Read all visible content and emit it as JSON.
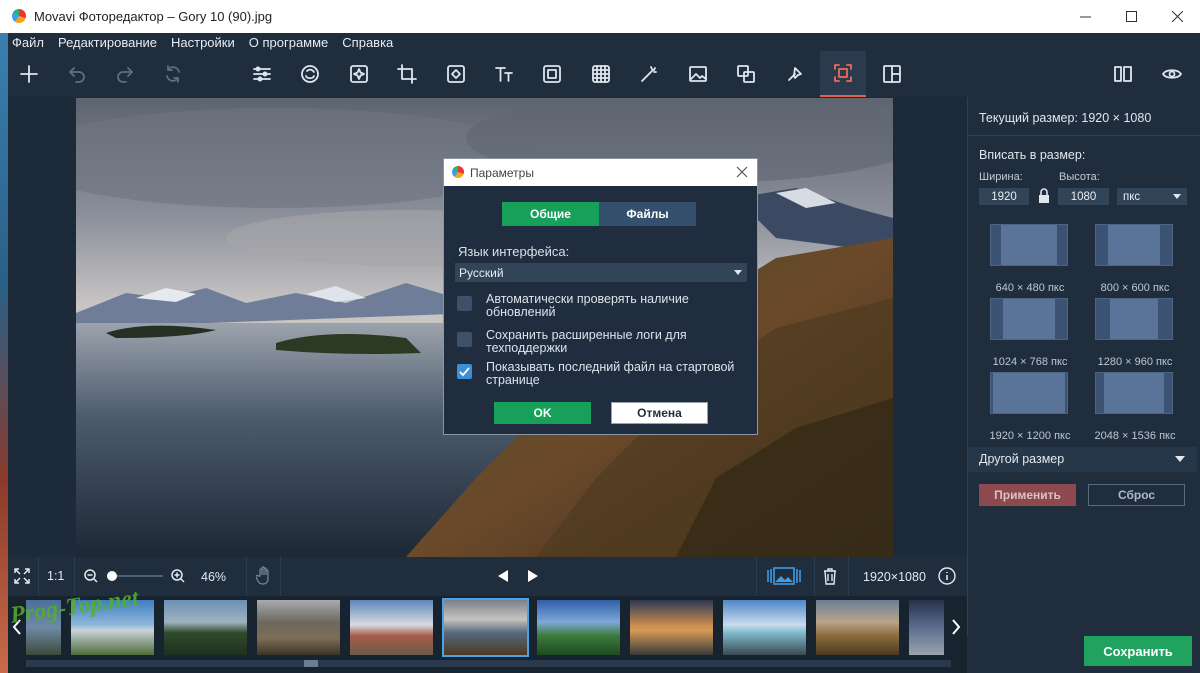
{
  "window": {
    "title": "Movavi Фоторедактор – Gory 10 (90).jpg"
  },
  "menu": [
    "Файл",
    "Редактирование",
    "Настройки",
    "О программе",
    "Справка"
  ],
  "toolbar": {
    "active_tool": "resize",
    "accent_color": "#e4604f"
  },
  "dialog": {
    "title": "Параметры",
    "tabs": [
      {
        "label": "Общие",
        "active": true
      },
      {
        "label": "Файлы",
        "active": false
      }
    ],
    "language_label": "Язык интерфейса:",
    "language_value": "Русский",
    "options": [
      {
        "label": "Автоматически проверять наличие обновлений",
        "checked": false
      },
      {
        "label": "Сохранить расширенные логи для техподдержки",
        "checked": false
      },
      {
        "label": "Показывать последний файл на стартовой странице",
        "checked": true
      }
    ],
    "ok_label": "OK",
    "cancel_label": "Отмена"
  },
  "right_panel": {
    "current_size": "Текущий размер: 1920 × 1080",
    "fit_label": "Вписать в размер:",
    "width_label": "Ширина:",
    "height_label": "Высота:",
    "width_value": "1920",
    "height_value": "1080",
    "unit": "пкс",
    "presets": [
      "640 × 480 пкс",
      "800 × 600 пкс",
      "1024 × 768 пкс",
      "1280 × 960 пкс",
      "1920 × 1200 пкс",
      "2048 × 1536 пкс"
    ],
    "other_size": "Другой размер",
    "apply_label": "Применить",
    "reset_label": "Сброс"
  },
  "bottom_bar": {
    "fit_ratio": "1:1",
    "zoom": "46%",
    "dimensions": "1920×1080"
  },
  "filmstrip": {
    "thumbnail_count": 10,
    "selected_index": 4
  },
  "save_label": "Сохранить",
  "watermark": "Prog-Top.net"
}
